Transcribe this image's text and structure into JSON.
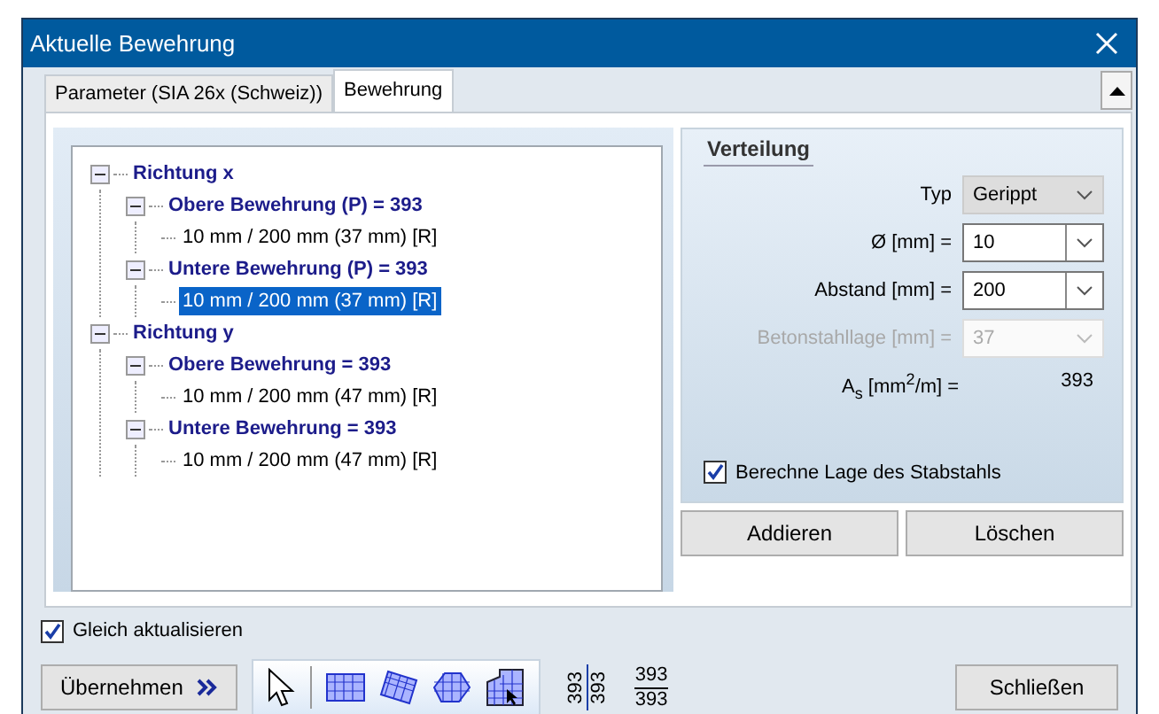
{
  "window": {
    "title": "Aktuelle Bewehrung"
  },
  "tabs": [
    {
      "label": "Parameter (SIA 26x (Schweiz))",
      "selected": false
    },
    {
      "label": "Bewehrung",
      "selected": true
    }
  ],
  "tree": [
    {
      "label": "Richtung x",
      "expanded": true,
      "selected": false,
      "children": [
        {
          "label": "Obere Bewehrung (P) = 393",
          "expanded": true,
          "selected": false,
          "children": [
            {
              "label": "10 mm / 200 mm (37 mm) [R]",
              "selected": false
            }
          ]
        },
        {
          "label": "Untere Bewehrung (P) = 393",
          "expanded": true,
          "selected": false,
          "children": [
            {
              "label": "10 mm / 200 mm (37 mm) [R]",
              "selected": true
            }
          ]
        }
      ]
    },
    {
      "label": "Richtung y",
      "expanded": true,
      "selected": false,
      "children": [
        {
          "label": "Obere Bewehrung = 393",
          "expanded": true,
          "selected": false,
          "children": [
            {
              "label": "10 mm / 200 mm (47 mm) [R]",
              "selected": false
            }
          ]
        },
        {
          "label": "Untere Bewehrung = 393",
          "expanded": true,
          "selected": false,
          "children": [
            {
              "label": "10 mm / 200 mm (47 mm) [R]",
              "selected": false
            }
          ]
        }
      ]
    }
  ],
  "verteilung": {
    "title": "Verteilung",
    "fields": [
      {
        "kind": "select",
        "label": "Typ",
        "value": "Gerippt",
        "disabled": false
      },
      {
        "kind": "combo",
        "label": "Ø [mm] =",
        "value": "10",
        "disabled": false
      },
      {
        "kind": "combo",
        "label": "Abstand [mm] =",
        "value": "200",
        "disabled": false
      },
      {
        "kind": "combo",
        "label": "Betonstahllage [mm] =",
        "value": "37",
        "disabled": true
      }
    ],
    "area": {
      "label": "A$_{s}$ [mm$^{2}$/m] =",
      "value": "393"
    },
    "checkbox": {
      "label": "Berechne Lage des Stabstahls",
      "checked": true
    },
    "buttons": [
      "Addieren",
      "Löschen"
    ]
  },
  "footer": {
    "checkbox": {
      "label": "Gleich aktualisieren",
      "checked": true
    },
    "apply_button": "Übernehmen",
    "tools": [
      {
        "kind": "pointer"
      },
      {
        "kind": "rectangle"
      },
      {
        "kind": "rotated"
      },
      {
        "kind": "polygon"
      },
      {
        "kind": "cutout"
      }
    ],
    "stacked_vertical": [
      "393",
      "393"
    ],
    "fraction": [
      "393",
      "393"
    ],
    "close_button": "Schließen"
  }
}
